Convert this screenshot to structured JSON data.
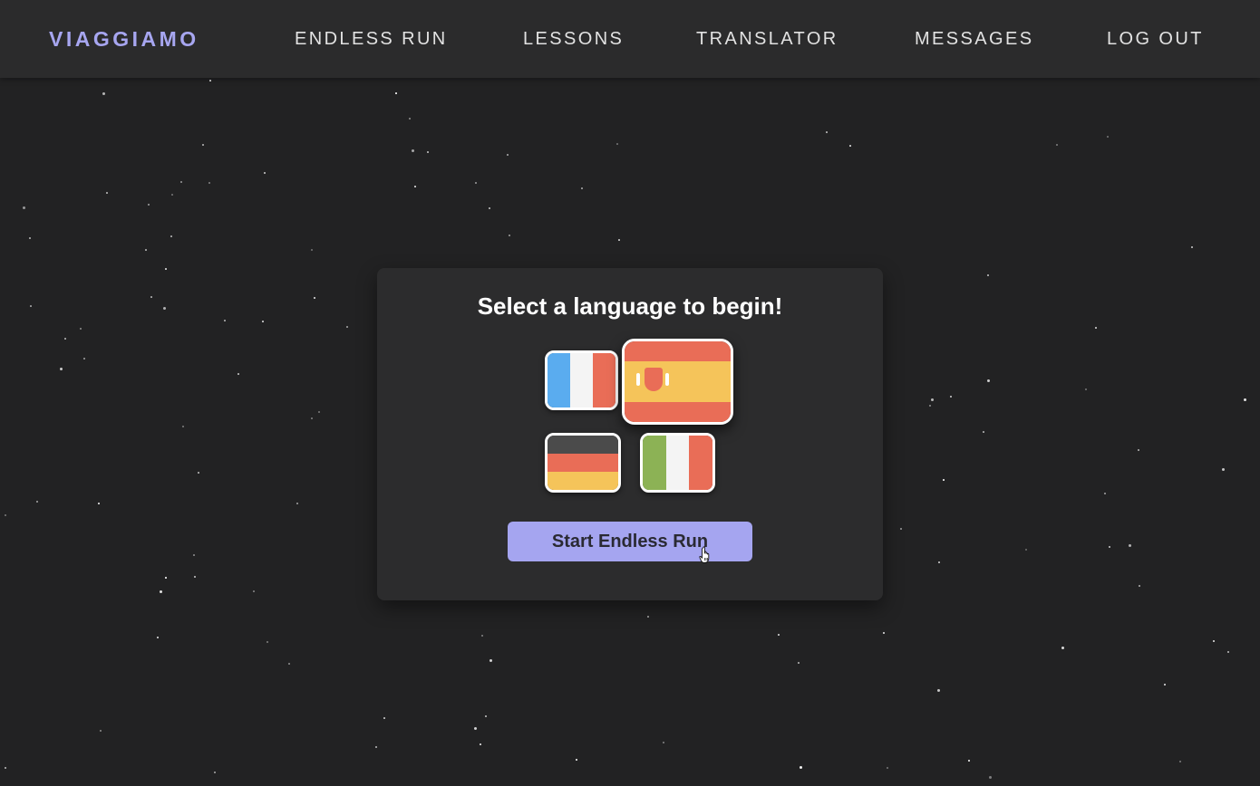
{
  "nav": {
    "brand": "VIAGGIAMO",
    "links": [
      {
        "label": "ENDLESS RUN"
      },
      {
        "label": "LESSONS"
      },
      {
        "label": "TRANSLATOR"
      },
      {
        "label": "MESSAGES"
      },
      {
        "label": "LOG OUT"
      }
    ]
  },
  "card": {
    "title": "Select a language to begin!",
    "flags": [
      {
        "icon": "france-flag-icon",
        "selected": false
      },
      {
        "icon": "spain-flag-icon",
        "selected": true
      },
      {
        "icon": "germany-flag-icon",
        "selected": false
      },
      {
        "icon": "italy-flag-icon",
        "selected": false
      }
    ],
    "start_label": "Start Endless Run"
  },
  "colors": {
    "background": "#222223",
    "nav_background": "#2b2b2c",
    "brand": "#a7a6f0",
    "accent_button": "#a5a5f0",
    "card": "#2c2c2d"
  }
}
